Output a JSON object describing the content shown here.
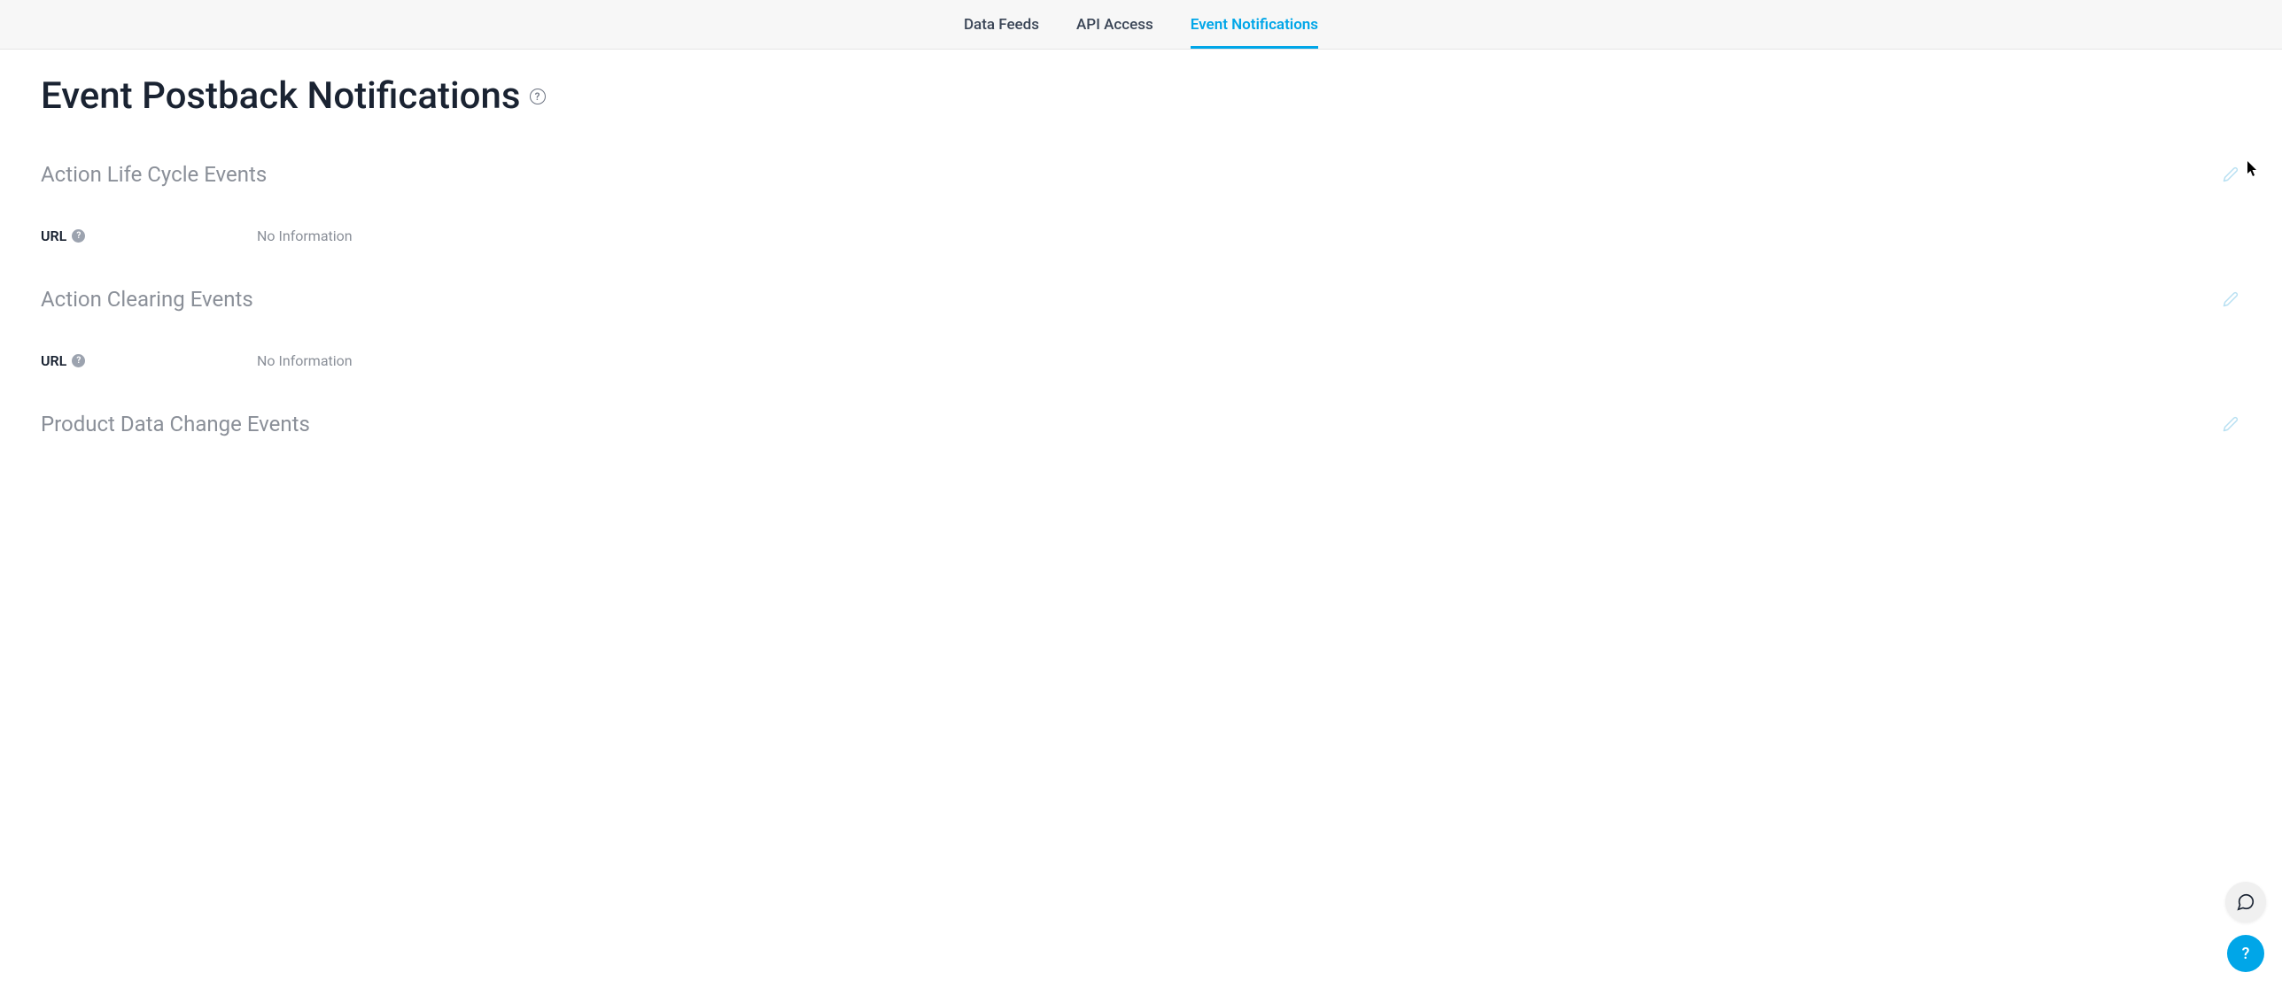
{
  "tabs": [
    {
      "label": "Data Feeds",
      "active": false
    },
    {
      "label": "API Access",
      "active": false
    },
    {
      "label": "Event Notifications",
      "active": true
    }
  ],
  "page": {
    "title": "Event Postback Notifications"
  },
  "sections": [
    {
      "title": "Action Life Cycle Events",
      "field_label": "URL",
      "field_value": "No Information"
    },
    {
      "title": "Action Clearing Events",
      "field_label": "URL",
      "field_value": "No Information"
    },
    {
      "title": "Product Data Change Events",
      "field_label": "",
      "field_value": ""
    }
  ],
  "colors": {
    "accent": "#00a6e8",
    "muted_text": "#8a8f98",
    "heading": "#1a2332",
    "edit_icon": "#b8e0f2",
    "tab_bg": "#f7f7f7"
  }
}
